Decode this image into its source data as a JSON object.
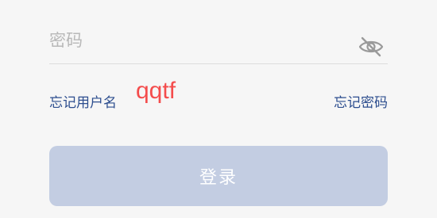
{
  "password": {
    "placeholder": "密码",
    "value": "",
    "visibility_icon": "eye-off-icon"
  },
  "links": {
    "forgot_username": "忘记用户名",
    "forgot_password": "忘记密码"
  },
  "annotation": "qqtf",
  "login_button": {
    "label": "登录",
    "background": "#c3cde2"
  },
  "colors": {
    "link": "#2c4d8e",
    "annotation": "#f44c4c"
  }
}
